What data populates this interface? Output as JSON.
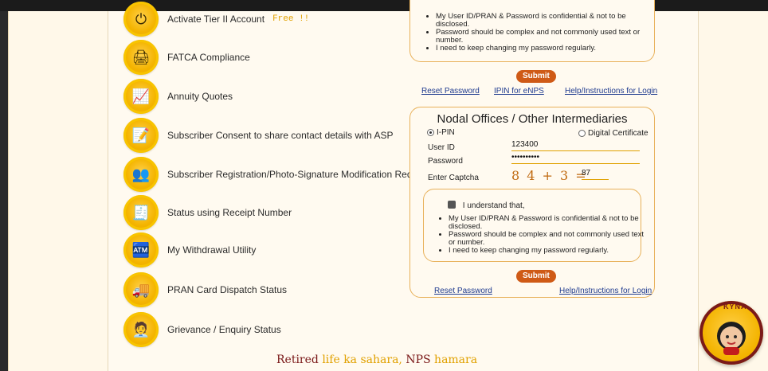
{
  "left_menu": [
    {
      "label": "Activate Tier II Account",
      "badge": "Free !!",
      "icon": "power-icon"
    },
    {
      "label": "FATCA Compliance",
      "icon": "printer-icon"
    },
    {
      "label": "Annuity Quotes",
      "icon": "chart-money-icon"
    },
    {
      "label": "Subscriber Consent to share contact details with ASP",
      "icon": "consent-form-icon"
    },
    {
      "label": "Subscriber Registration/Photo-Signature Modification Request",
      "icon": "people-group-icon"
    },
    {
      "label": "Status using Receipt Number",
      "icon": "receipt-icon"
    },
    {
      "label": "My Withdrawal Utility",
      "icon": "atm-withdrawal-icon"
    },
    {
      "label": "PRAN Card Dispatch Status",
      "icon": "delivery-truck-icon"
    },
    {
      "label": "Grievance / Enquiry Status",
      "icon": "support-person-icon"
    }
  ],
  "subscriber_panel": {
    "bullets": [
      "My User ID/PRAN & Password is confidential & not to be disclosed.",
      "Password should be complex and not commonly used text or number.",
      "I need to keep changing my password regularly."
    ],
    "submit_label": "Submit",
    "links": {
      "reset": "Reset Password",
      "ipin": "IPIN for eNPS",
      "help": "Help/Instructions for Login"
    }
  },
  "nodal_panel": {
    "title": "Nodal Offices / Other Intermediaries",
    "radio_ipin": "I-PIN",
    "radio_digital": "Digital Certificate",
    "user_id_label": "User ID",
    "user_id_value": "123400",
    "password_label": "Password",
    "password_value": "••••••••••",
    "captcha_label": "Enter Captcha",
    "captcha_text": "8 4 + 3 =",
    "captcha_answer": "87",
    "consent_text": "I understand that,",
    "bullets": [
      "My User ID/PRAN & Password is confidential & not to be disclosed.",
      "Password should be complex and not commonly used text or number.",
      "I need to keep changing my password regularly."
    ],
    "submit_label": "Submit",
    "links": {
      "reset": "Reset Password",
      "help": "Help/Instructions for Login"
    }
  },
  "tagline": {
    "part1": "Retired ",
    "part2": "life ka sahara, ",
    "part3": "NPS ",
    "part4": "hamara"
  },
  "kyna_label": "KYNA"
}
